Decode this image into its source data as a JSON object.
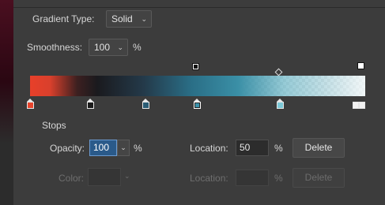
{
  "gradient_type": {
    "label": "Gradient Type:",
    "value": "Solid"
  },
  "smoothness": {
    "label": "Smoothness:",
    "value": "100",
    "unit": "%"
  },
  "stops_section": {
    "title": "Stops"
  },
  "opacity_row": {
    "opacity_label": "Opacity:",
    "opacity_value": "100",
    "opacity_unit": "%",
    "location_label": "Location:",
    "location_value": "50",
    "location_unit": "%",
    "delete_label": "Delete"
  },
  "color_row": {
    "color_label": "Color:",
    "location_label": "Location:",
    "location_unit": "%",
    "delete_label": "Delete"
  },
  "colors": {
    "opacity_stop": "#ffffff",
    "color_stops": [
      "#e8452d",
      "#e6e6e6",
      "#e6e6e6",
      "#5ab6cc",
      "#5ab6cc",
      "#e6e6e6"
    ]
  },
  "icons": [
    "chevron-down-icon",
    "opacity-stop-icon",
    "color-stop-icon",
    "midpoint-diamond-icon"
  ]
}
